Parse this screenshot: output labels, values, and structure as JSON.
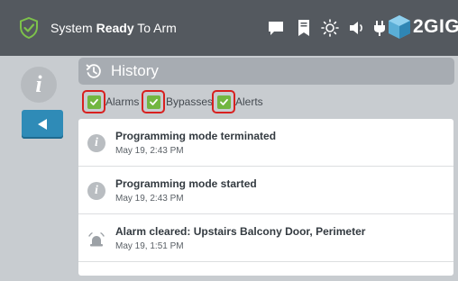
{
  "status_bar": {
    "prefix": "System ",
    "state": "Ready",
    "suffix": " To Arm",
    "icons": [
      "shield-check-icon",
      "message-icon",
      "bookmark-icon",
      "brightness-icon",
      "volume-icon",
      "plug-icon"
    ],
    "brand": "2GIG"
  },
  "sidebar": {
    "info_icon": "i",
    "back_button": "back-arrow-icon"
  },
  "history": {
    "title": "History",
    "filters": [
      {
        "label": "Alarms",
        "checked": true
      },
      {
        "label": "Bypasses",
        "checked": true
      },
      {
        "label": "Alerts",
        "checked": true
      }
    ],
    "events": [
      {
        "icon": "info-icon",
        "title": "Programming mode terminated",
        "time": "May 19, 2:43 PM"
      },
      {
        "icon": "info-icon",
        "title": "Programming mode started",
        "time": "May 19, 2:43 PM"
      },
      {
        "icon": "siren-icon",
        "title": "Alarm cleared: Upstairs Balcony Door, Perimeter",
        "time": "May 19, 1:51 PM"
      }
    ]
  },
  "colors": {
    "topbar": "#54595f",
    "background": "#c8ccd0",
    "accent_blue": "#2f8bb7",
    "check_green": "#72b640",
    "highlight_red": "#d8201f"
  }
}
